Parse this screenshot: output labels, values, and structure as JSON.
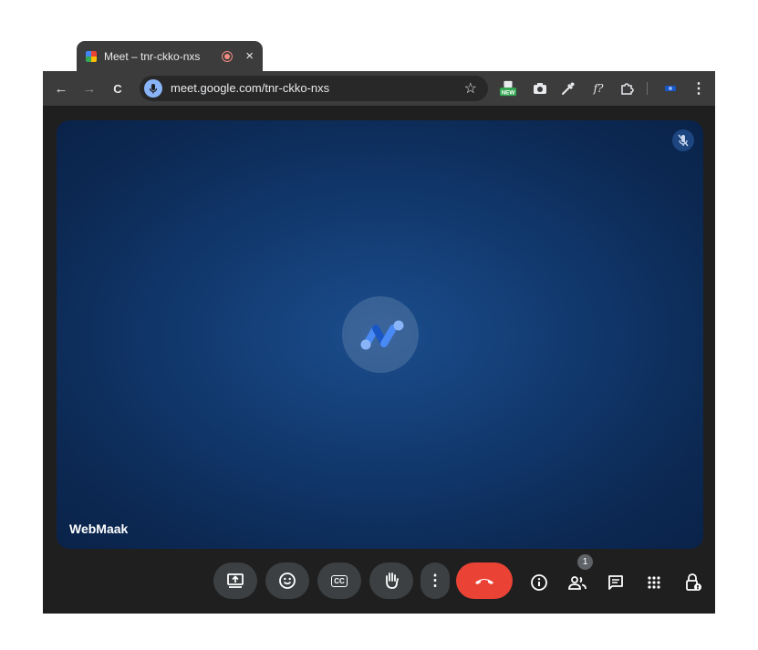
{
  "browser": {
    "tab": {
      "title": "Meet – tnr-ckko-nxs",
      "close_glyph": "×"
    },
    "nav": {
      "back": "←",
      "forward": "→",
      "reload": "C"
    },
    "address_bar": {
      "url": "meet.google.com/tnr-ckko-nxs",
      "bookmark_glyph": "☆"
    },
    "extensions": [
      {
        "name": "new-extension-icon",
        "badge": "NEW"
      },
      {
        "name": "camera-extension-icon"
      },
      {
        "name": "eyedropper-extension-icon"
      },
      {
        "name": "font-extension-icon",
        "label": "f?"
      },
      {
        "name": "extensions-puzzle-icon"
      },
      {
        "name": "profile-extension-icon"
      },
      {
        "name": "browser-menu-icon",
        "label": "⋮"
      }
    ]
  },
  "meet": {
    "participant": {
      "name": "WebMaak",
      "muted": true
    },
    "controls": [
      {
        "name": "present-screen-button"
      },
      {
        "name": "emoji-reaction-button"
      },
      {
        "name": "captions-button",
        "label": "CC"
      },
      {
        "name": "raise-hand-button"
      },
      {
        "name": "more-options-button",
        "label": "⋮"
      },
      {
        "name": "leave-call-button"
      }
    ],
    "side_controls": [
      {
        "name": "meeting-info-button",
        "label": "i"
      },
      {
        "name": "people-button"
      },
      {
        "name": "chat-button"
      },
      {
        "name": "activities-button"
      },
      {
        "name": "host-controls-button"
      }
    ],
    "people_count": "1"
  },
  "colors": {
    "toolbar": "#3c3c3c",
    "stage_center": "#1b4d8c",
    "stage_edge": "#0a2249",
    "end_call": "#ea4335",
    "control_bg": "#3c4043",
    "accent_blue": "#8ab4f8"
  }
}
